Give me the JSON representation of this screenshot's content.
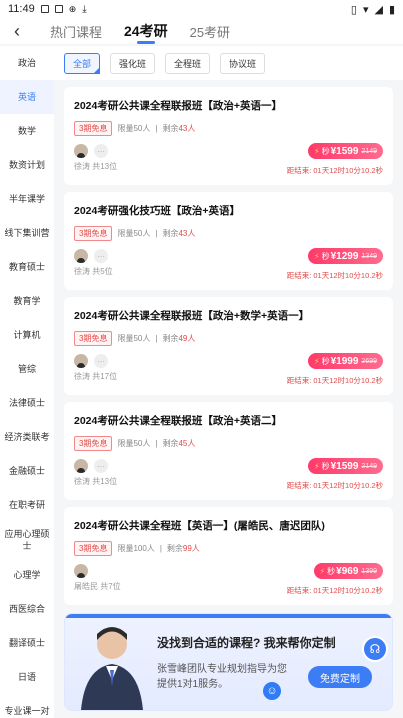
{
  "status": {
    "time": "11:49"
  },
  "tabs": [
    {
      "label": "热门课程"
    },
    {
      "label": "24考研"
    },
    {
      "label": "25考研"
    }
  ],
  "sidebar": [
    {
      "label": "政治"
    },
    {
      "label": "英语"
    },
    {
      "label": "数学"
    },
    {
      "label": "数资计划"
    },
    {
      "label": "半年课学"
    },
    {
      "label": "线下集训营"
    },
    {
      "label": "教育硕士"
    },
    {
      "label": "教育学"
    },
    {
      "label": "计算机"
    },
    {
      "label": "管综"
    },
    {
      "label": "法律硕士"
    },
    {
      "label": "经济类联考"
    },
    {
      "label": "金融硕士"
    },
    {
      "label": "在职考研"
    },
    {
      "label": "应用心理硕士"
    },
    {
      "label": "心理学"
    },
    {
      "label": "西医综合"
    },
    {
      "label": "翻译硕士"
    },
    {
      "label": "日语"
    },
    {
      "label": "专业课一对"
    }
  ],
  "filters": [
    {
      "label": "全部"
    },
    {
      "label": "强化班"
    },
    {
      "label": "全程班"
    },
    {
      "label": "协议班"
    }
  ],
  "courses": [
    {
      "title": "2024考研公共课全程联报班【政治+英语一】",
      "badge": "3期免息",
      "limit": "限量50人",
      "remain_label": "剩余",
      "remain": "43人",
      "teachers": "徐涛   共13位",
      "miao": "秒",
      "price": "¥1599",
      "orig": "2149",
      "countdown": "距结束: 01天12时10分10.2秒"
    },
    {
      "title": "2024考研强化技巧班【政治+英语】",
      "badge": "3期免息",
      "limit": "限量50人",
      "remain_label": "剩余",
      "remain": "43人",
      "teachers": "徐涛   共5位",
      "miao": "秒",
      "price": "¥1299",
      "orig": "1349",
      "countdown": "距结束: 01天12时10分10.2秒"
    },
    {
      "title": "2024考研公共课全程联报班【政治+数学+英语一】",
      "badge": "3期免息",
      "limit": "限量50人",
      "remain_label": "剩余",
      "remain": "49人",
      "teachers": "徐涛   共17位",
      "miao": "秒",
      "price": "¥1999",
      "orig": "2699",
      "countdown": "距结束: 01天12时10分10.2秒"
    },
    {
      "title": "2024考研公共课全程联报班【政治+英语二】",
      "badge": "3期免息",
      "limit": "限量50人",
      "remain_label": "剩余",
      "remain": "45人",
      "teachers": "徐涛   共13位",
      "miao": "秒",
      "price": "¥1599",
      "orig": "2149",
      "countdown": "距结束: 01天12时10分10.2秒"
    },
    {
      "title": "2024考研公共课全程班【英语一】(屠皓民、唐迟团队)",
      "badge": "3期免息",
      "limit": "限量100人",
      "remain_label": "剩余",
      "remain": "99人",
      "teachers": "屠皓民   共7位",
      "miao": "秒",
      "price": "¥969",
      "orig": "1399",
      "countdown": "距结束: 01天12时10分10.2秒"
    }
  ],
  "banner": {
    "title": "没找到合适的课程? 我来帮你定制",
    "subtitle": "张雪峰团队专业规划指导为您提供1对1服务。",
    "button": "免费定制"
  },
  "colors": {
    "accent": "#3c7cf4",
    "price": "#ff3a6b"
  }
}
